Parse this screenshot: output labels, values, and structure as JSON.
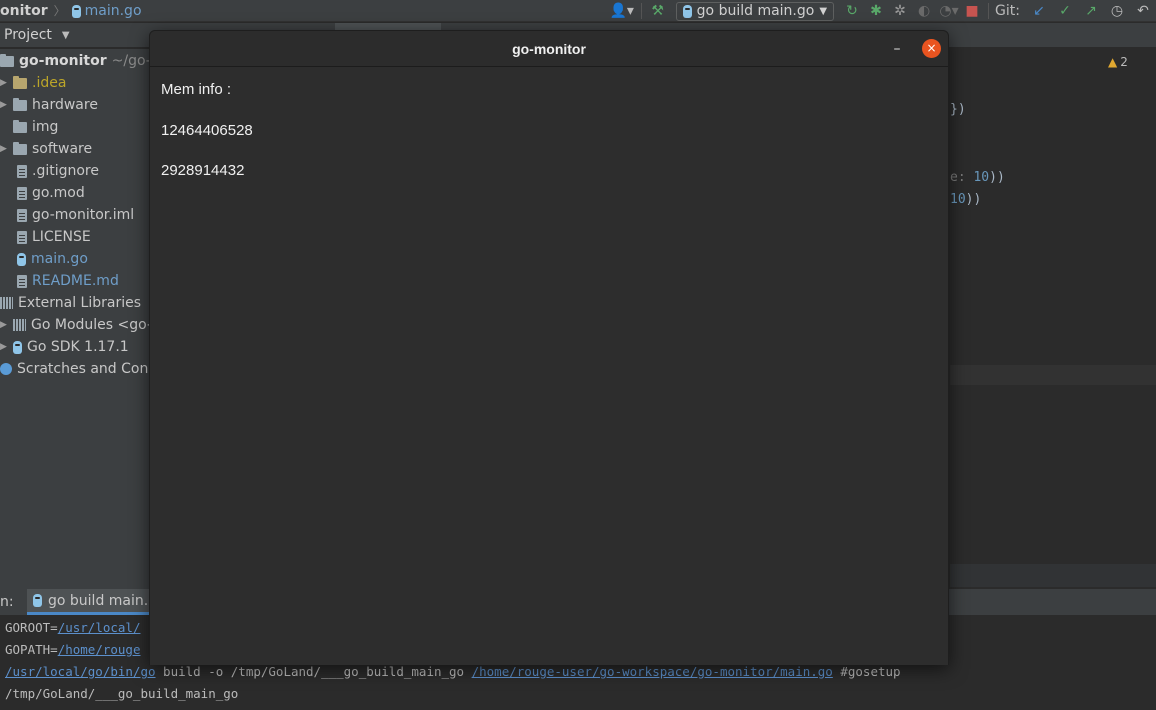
{
  "ide": {
    "breadcrumb": {
      "project": "onitor",
      "file": "main.go"
    },
    "toolbar": {
      "run_config": "go build main.go",
      "git_label": "Git:"
    },
    "project_pane": {
      "title": "Project",
      "root_name": "go-monitor",
      "root_path": "~/go-w",
      "items": [
        {
          "label": ".idea"
        },
        {
          "label": "hardware"
        },
        {
          "label": "img"
        },
        {
          "label": "software"
        },
        {
          "label": ".gitignore"
        },
        {
          "label": "go.mod"
        },
        {
          "label": "go-monitor.iml"
        },
        {
          "label": "LICENSE"
        },
        {
          "label": "main.go"
        },
        {
          "label": "README.md"
        },
        {
          "label": "External Libraries"
        },
        {
          "label": "Go Modules <go-"
        },
        {
          "label": "Go SDK 1.17.1"
        },
        {
          "label": "Scratches and Conso"
        }
      ]
    },
    "editor": {
      "warnings_count": "2",
      "frag1": "})",
      "frag2_hint": "e:",
      "frag2_num": "10",
      "frag2_tail": "))",
      "frag3_num": "10",
      "frag3_tail": "))"
    },
    "run_panel": {
      "label": "n:",
      "tab_label": "go build main.g",
      "console": {
        "goroot_key": "GOROOT=",
        "goroot_val": "/usr/local/",
        "gopath_key": "GOPATH=",
        "gopath_val": "/home/rouge",
        "cmd_bin": "/usr/local/go/bin/go",
        "cmd_mid": " build -o /tmp/GoLand/___go_build_main_go ",
        "cmd_path": "/home/rouge-user/go-workspace/go-monitor/main.go",
        "cmd_tail": " #gosetup",
        "output": "/tmp/GoLand/___go_build_main_go"
      }
    }
  },
  "app": {
    "title": "go-monitor",
    "minimize_label": "–",
    "close_label": "×",
    "mem_label": "Mem info :",
    "mem_total": "12464406528",
    "mem_free": "2928914432"
  }
}
